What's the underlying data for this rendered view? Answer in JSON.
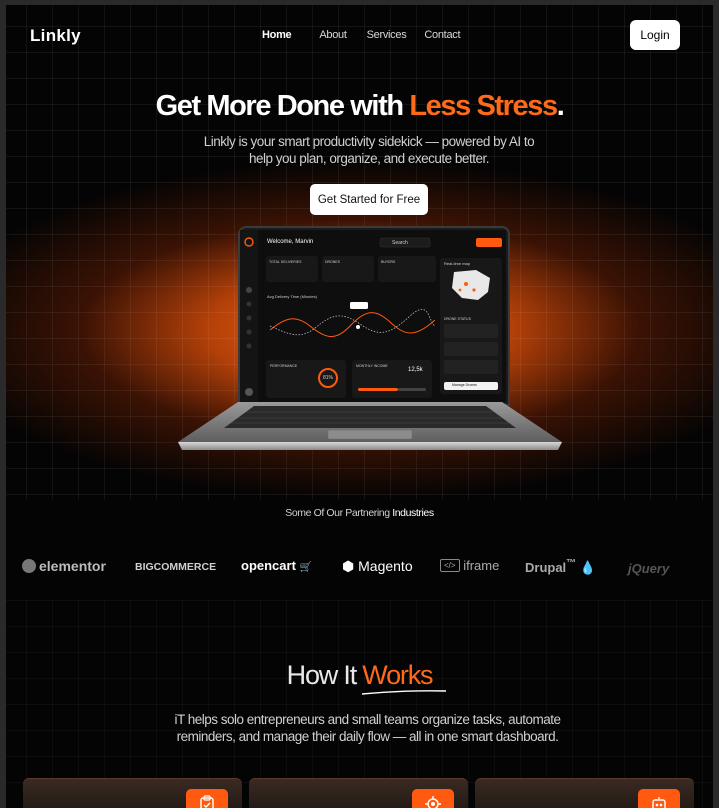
{
  "brand": {
    "name": "Linkly",
    "accent": "#ff6a1a"
  },
  "nav": {
    "links": [
      {
        "label": "Home",
        "active": true
      },
      {
        "label": "About",
        "active": false
      },
      {
        "label": "Services",
        "active": false
      },
      {
        "label": "Contact",
        "active": false
      }
    ],
    "login_label": "Login"
  },
  "hero": {
    "title_main": "Get More Done with ",
    "title_accent": "Less Stress",
    "title_end": ".",
    "subtitle": "Linkly is your smart productivity sidekick — powered by AI to help you plan, organize, and execute better.",
    "cta_label": "Get Started for Free"
  },
  "dashboard": {
    "welcome": "Welcome, Marvin",
    "search_placeholder": "Search",
    "cards": [
      "TOTAL DELIVERIES",
      "DRONES",
      "BUYERS"
    ],
    "chart_title": "Avg Delivery Time (Minutes)",
    "map_title": "Real-time map",
    "panel_title": "DRONE STATUS",
    "performance": "PERFORMANCE",
    "performance_value": "81%",
    "monthly_income": "MONTHLY INCOME",
    "income_value": "12,5k",
    "manage_label": "Manage Drones"
  },
  "partners": {
    "label_prefix": "Some Of Our Partnering ",
    "label_bold": "Industries",
    "logos": [
      "elementor",
      "BIGCOMMERCE",
      "opencart",
      "Magento",
      "iframe",
      "Drupal",
      "jQuery"
    ]
  },
  "how": {
    "title_main": "How It ",
    "title_accent": "Works",
    "subtitle": "iT helps solo entrepreneurs and small teams organize tasks, automate reminders, and manage their daily flow — all in one smart dashboard.",
    "cards": [
      {
        "icon": "clipboard-icon"
      },
      {
        "icon": "gear-brain-icon"
      },
      {
        "icon": "robot-icon"
      }
    ]
  }
}
